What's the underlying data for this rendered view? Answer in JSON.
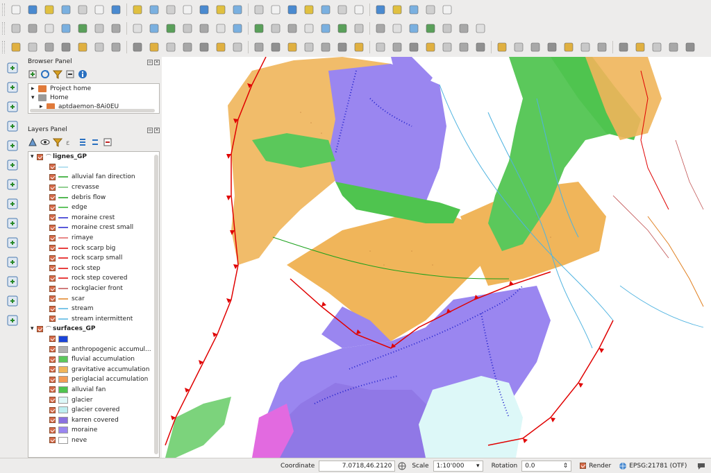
{
  "browser_panel": {
    "title": "Browser Panel",
    "items": [
      {
        "label": "Project home"
      },
      {
        "label": "Home"
      },
      {
        "label": "aptdaemon-8Ai0EU"
      }
    ]
  },
  "layers_panel": {
    "title": "Layers Panel",
    "groups": [
      {
        "name": "lignes_GP",
        "items": [
          {
            "label": "",
            "color": "#9fd7ea"
          },
          {
            "label": "alluvial fan direction",
            "color": "#1aa01a"
          },
          {
            "label": "crevasse",
            "color": "#6fbf6f"
          },
          {
            "label": "debris flow",
            "color": "#1aa01a"
          },
          {
            "label": "edge",
            "color": "#2fb02f"
          },
          {
            "label": "moraine crest",
            "color": "#2222cc"
          },
          {
            "label": "moraine crest small",
            "color": "#2222cc"
          },
          {
            "label": "rimaye",
            "color": "#e06060"
          },
          {
            "label": "rock scarp big",
            "color": "#e00000"
          },
          {
            "label": "rock scarp small",
            "color": "#e00000"
          },
          {
            "label": "rock step",
            "color": "#e00000"
          },
          {
            "label": "rock step covered",
            "color": "#e00000"
          },
          {
            "label": "rockglacier front",
            "color": "#c05050"
          },
          {
            "label": "scar",
            "color": "#e08020"
          },
          {
            "label": "stream",
            "color": "#4fb3e0"
          },
          {
            "label": "stream intermittent",
            "color": "#4fb3e0"
          }
        ]
      },
      {
        "name": "surfaces_GP",
        "items": [
          {
            "label": "",
            "color": "#1a44d9"
          },
          {
            "label": "anthropogenic accumul...",
            "color": "#b0b0b0"
          },
          {
            "label": "fluvial accumulation",
            "color": "#5bc85b"
          },
          {
            "label": "gravitative accumulation",
            "color": "#f0b55a"
          },
          {
            "label": "periglacial accumulation",
            "color": "#f39b55"
          },
          {
            "label": "alluvial fan",
            "color": "#4fc44f"
          },
          {
            "label": "glacier",
            "color": "#ddf8f8"
          },
          {
            "label": "glacier covered",
            "color": "#bdeef0"
          },
          {
            "label": "karren covered",
            "color": "#8a70e0"
          },
          {
            "label": "moraine",
            "color": "#9a86f0"
          },
          {
            "label": "neve",
            "color": "#ffffff"
          }
        ]
      }
    ]
  },
  "statusbar": {
    "coordinate_label": "Coordinate",
    "coordinate_value": "7.0718,46.2120",
    "scale_label": "Scale",
    "scale_value": "1:10'000",
    "rotation_label": "Rotation",
    "rotation_value": "0.0",
    "render_label": "Render",
    "crs_label": "EPSG:21781 (OTF)"
  }
}
